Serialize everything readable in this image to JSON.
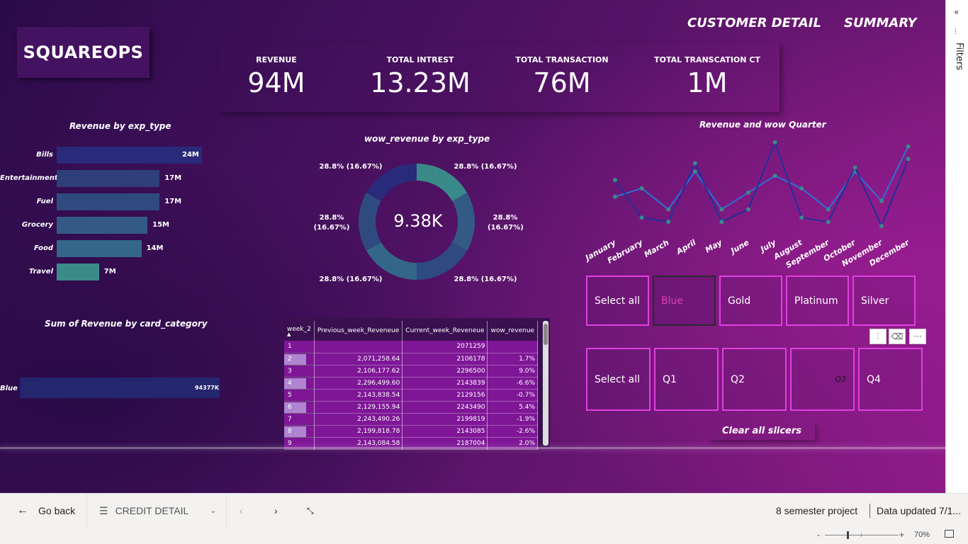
{
  "report": {
    "logo": "SQUAREOPS",
    "nav": {
      "customer_detail": "CUSTOMER DETAIL",
      "summary": "SUMMARY"
    }
  },
  "kpis": [
    {
      "label": "REVENUE",
      "value": "94M"
    },
    {
      "label": "TOTAL INTREST",
      "value": "13.23M"
    },
    {
      "label": "TOTAL TRANSACTION",
      "value": "76M"
    },
    {
      "label": "TOTAL TRANSCATION CT",
      "value": "1M"
    }
  ],
  "visuals": {
    "revenue_by_exp_type": {
      "title": "Revenue by exp_type"
    },
    "wow_revenue_by_exp_type": {
      "title": "wow_revenue by exp_type",
      "center": "9.38K"
    },
    "revenue_wow_quarter": {
      "title": "Revenue and wow Quarter"
    },
    "revenue_by_card_category": {
      "title": "Sum of Revenue by card_category"
    }
  },
  "chart_data": [
    {
      "type": "bar",
      "title": "Revenue by exp_type",
      "categories": [
        "Bills",
        "Entertainment",
        "Fuel",
        "Grocery",
        "Food",
        "Travel"
      ],
      "values": [
        24,
        17,
        17,
        15,
        14,
        7
      ],
      "value_labels": [
        "24M",
        "17M",
        "17M",
        "15M",
        "14M",
        "7M"
      ],
      "colors": [
        "#2a2a7a",
        "#2e3f7a",
        "#2f4a7f",
        "#325a85",
        "#34668a",
        "#3a8a8a"
      ]
    },
    {
      "type": "pie",
      "title": "wow_revenue by exp_type",
      "categories": [
        "",
        "",
        "",
        "",
        "",
        ""
      ],
      "values": [
        16.67,
        16.67,
        16.67,
        16.67,
        16.67,
        16.67
      ],
      "labels": [
        "28.8% (16.67%)",
        "28.8% (16.67%)",
        "28.8% (16.67%)",
        "28.8% (16.67%)",
        "28.8% (16.67%)",
        "28.8% (16.67%)"
      ],
      "colors": [
        "#3a8a8a",
        "#325a85",
        "#2e4a80",
        "#34668a",
        "#2f4a7f",
        "#2a2a7a"
      ]
    },
    {
      "type": "line",
      "title": "Revenue and wow Quarter",
      "x": [
        "January",
        "February",
        "March",
        "April",
        "May",
        "June",
        "July",
        "August",
        "September",
        "October",
        "November",
        "December"
      ],
      "series": [
        {
          "values": [
            6,
            8,
            3,
            12,
            3,
            7,
            11,
            8,
            3,
            12,
            5,
            18
          ],
          "color": "#2f6fd6"
        },
        {
          "values": [
            10,
            1,
            0,
            14,
            0,
            3,
            19,
            1,
            0,
            13,
            -1,
            15
          ],
          "color": "#232e9a"
        }
      ],
      "ylim": [
        -2,
        20
      ]
    },
    {
      "type": "bar",
      "title": "Sum of Revenue by card_category",
      "categories": [
        "Blue"
      ],
      "values": [
        94377
      ],
      "value_labels": [
        "94377K"
      ],
      "colors": [
        "#24266e"
      ]
    }
  ],
  "table": {
    "columns": [
      "week_2",
      "Previous_week_Reveneue",
      "Current_week_Reveneue",
      "wow_revenue"
    ],
    "rows": [
      {
        "week": "1",
        "prev": "",
        "curr": "2071259",
        "wow": "",
        "bar": 0
      },
      {
        "week": "2",
        "prev": "2,071,258.64",
        "curr": "2106178",
        "wow": "1.7%",
        "bar": 0.74
      },
      {
        "week": "3",
        "prev": "2,106,177.62",
        "curr": "2296500",
        "wow": "9.0%",
        "bar": 0.0
      },
      {
        "week": "4",
        "prev": "2,296,499.60",
        "curr": "2143839",
        "wow": "-6.6%",
        "bar": 0.74
      },
      {
        "week": "5",
        "prev": "2,143,838.54",
        "curr": "2129156",
        "wow": "-0.7%",
        "bar": 0.0
      },
      {
        "week": "6",
        "prev": "2,129,155.94",
        "curr": "2243490",
        "wow": "5.4%",
        "bar": 0.74
      },
      {
        "week": "7",
        "prev": "2,243,490.26",
        "curr": "2199819",
        "wow": "-1.9%",
        "bar": 0.0
      },
      {
        "week": "8",
        "prev": "2,199,818.78",
        "curr": "2143085",
        "wow": "-2.6%",
        "bar": 0.74
      },
      {
        "week": "9",
        "prev": "2,143,084.58",
        "curr": "2187004",
        "wow": "2.0%",
        "bar": 0.0
      }
    ]
  },
  "slicers": {
    "card": [
      "Select all",
      "Blue",
      "Gold",
      "Platinum",
      "Silver"
    ],
    "card_selected": "Blue",
    "quarter": [
      "Select all",
      "Q1",
      "Q2",
      "Q3",
      "Q4"
    ],
    "clear": "Clear all slicers"
  },
  "filters_pane": {
    "label": "Filters"
  },
  "bottom_bar": {
    "go_back": "Go back",
    "page": "CREDIT DETAIL",
    "workspace": "8 semester project",
    "data_updated": "Data updated 7/1...",
    "zoom": "70%"
  }
}
